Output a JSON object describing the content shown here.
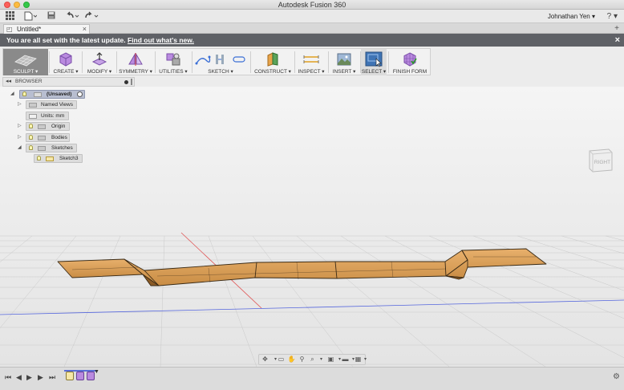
{
  "window": {
    "title": "Autodesk Fusion 360"
  },
  "quickbar": {
    "user": "Johnathan Yen ▾",
    "help": "? ▾"
  },
  "tab": {
    "label": "Untitled*",
    "close": "×",
    "new": "+"
  },
  "notification": {
    "text": "You are all set with the latest update. ",
    "link": "Find out what's new.",
    "close": "×"
  },
  "toolbar": {
    "groups": [
      {
        "id": "sculpt",
        "label": "SCULPT ▾",
        "icon": "sculpt-workspace-icon"
      },
      {
        "id": "create",
        "label": "CREATE ▾",
        "icon": "create-box-icon"
      },
      {
        "id": "modify",
        "label": "MODIFY ▾",
        "icon": "modify-icon"
      },
      {
        "id": "symmetry",
        "label": "SYMMETRY ▾",
        "icon": "symmetry-icon"
      },
      {
        "id": "utilities",
        "label": "UTILITIES ▾",
        "icon": "utilities-icon"
      },
      {
        "id": "sketch",
        "label": "SKETCH ▾",
        "icon": "sketch-icon"
      },
      {
        "id": "construct",
        "label": "CONSTRUCT ▾",
        "icon": "construct-plane-icon"
      },
      {
        "id": "inspect",
        "label": "INSPECT ▾",
        "icon": "inspect-measure-icon"
      },
      {
        "id": "insert",
        "label": "INSERT ▾",
        "icon": "insert-image-icon"
      },
      {
        "id": "select",
        "label": "SELECT ▾",
        "icon": "select-cursor-icon"
      },
      {
        "id": "finish",
        "label": "FINISH FORM",
        "icon": "finish-form-icon"
      }
    ]
  },
  "browser": {
    "title": "BROWSER",
    "root": "(Unsaved)",
    "items": [
      {
        "label": "Named Views"
      },
      {
        "label": "Units: mm"
      },
      {
        "label": "Origin"
      },
      {
        "label": "Bodies"
      },
      {
        "label": "Sketches"
      },
      {
        "label": "Sketch3"
      }
    ]
  },
  "viewcube": {
    "face": "RIGHT"
  },
  "colors": {
    "notification_bg": "#5f6166",
    "body_fill": "#dfa15b",
    "body_edge": "#3a2a15",
    "x_axis": "#e05555",
    "y_axis": "#5566dd",
    "sculpt_active": "#8a8a8a"
  }
}
